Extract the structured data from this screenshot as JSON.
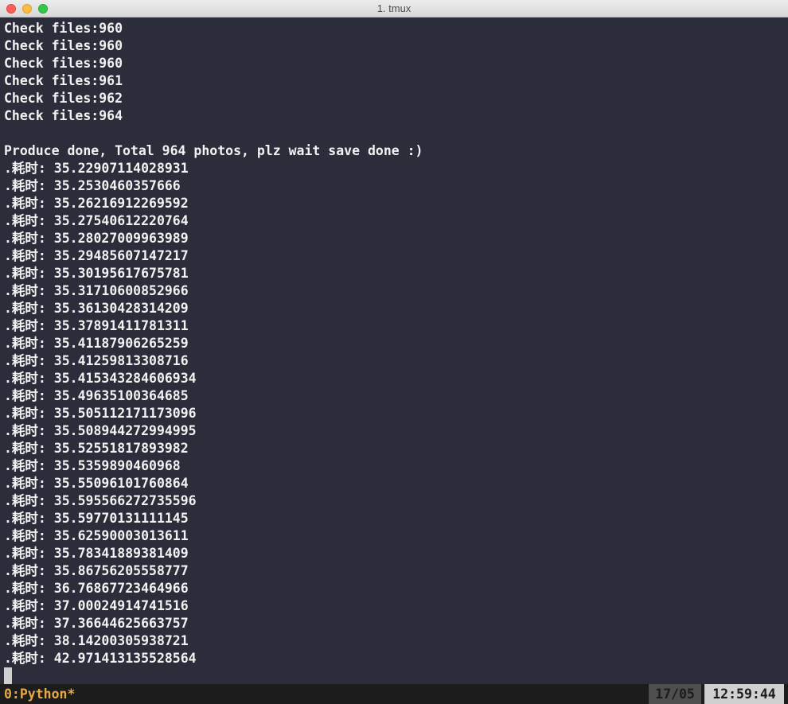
{
  "window": {
    "title": "1. tmux"
  },
  "terminal": {
    "lines": [
      "Check files:960",
      "Check files:960",
      "Check files:960",
      "Check files:961",
      "Check files:962",
      "Check files:964",
      "",
      "Produce done, Total 964 photos, plz wait save done :)",
      ".耗时: 35.22907114028931",
      ".耗时: 35.2530460357666",
      ".耗时: 35.26216912269592",
      ".耗时: 35.27540612220764",
      ".耗时: 35.28027009963989",
      ".耗时: 35.29485607147217",
      ".耗时: 35.30195617675781",
      ".耗时: 35.31710600852966",
      ".耗时: 35.36130428314209",
      ".耗时: 35.37891411781311",
      ".耗时: 35.41187906265259",
      ".耗时: 35.41259813308716",
      ".耗时: 35.415343284606934",
      ".耗时: 35.49635100364685",
      ".耗时: 35.505112171173096",
      ".耗时: 35.508944272994995",
      ".耗时: 35.52551817893982",
      ".耗时: 35.5359890460968",
      ".耗时: 35.55096101760864",
      ".耗时: 35.595566272735596",
      ".耗时: 35.59770131111145",
      ".耗时: 35.62590003013611",
      ".耗时: 35.78341889381409",
      ".耗时: 35.86756205558777",
      ".耗时: 36.76867723464966",
      ".耗时: 37.00024914741516",
      ".耗时: 37.36644625663757",
      ".耗时: 38.14200305938721",
      ".耗时: 42.971413135528564"
    ]
  },
  "statusbar": {
    "session": "0:Python*",
    "date": "17/05",
    "time": "12:59:44"
  },
  "colors": {
    "terminal_bg": "#2b2d3a",
    "text": "#f2f2f2",
    "status_bg": "#1c1c1c",
    "session_fg": "#e6a94b",
    "date_bg": "#4e4e4e",
    "time_bg": "#d0d0d0"
  }
}
